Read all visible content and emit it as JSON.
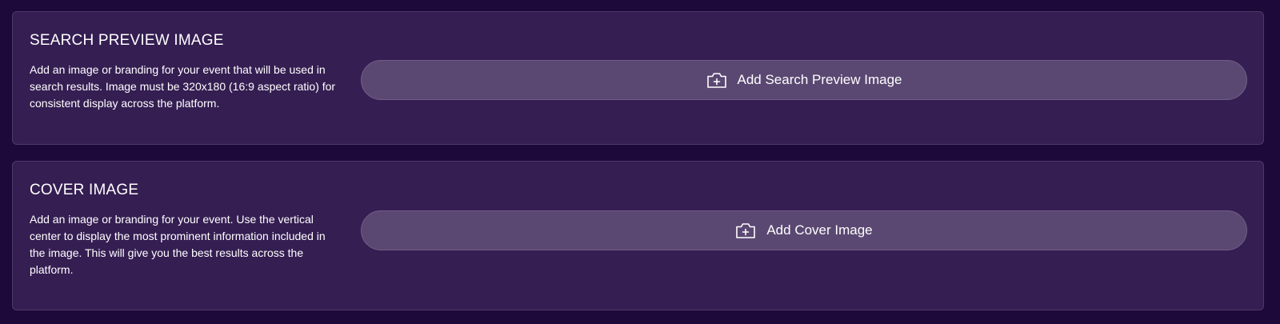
{
  "search_preview": {
    "title": "SEARCH PREVIEW IMAGE",
    "description": "Add an image or branding for your event that will be used in search results. Image must be 320x180 (16:9 aspect ratio) for consistent display across the platform.",
    "button_label": "Add Search Preview Image",
    "button_icon": "camera-plus-icon"
  },
  "cover_image": {
    "title": "COVER IMAGE",
    "description": "Add an image or branding for your event. Use the vertical center to display the most prominent information included in the image. This will give you the best results across the platform.",
    "button_label": "Add Cover Image",
    "button_icon": "camera-plus-icon"
  },
  "colors": {
    "page_background": "#1e0a3a",
    "card_background": "#351e52",
    "button_background": "#5a4872",
    "text": "#ffffff"
  }
}
